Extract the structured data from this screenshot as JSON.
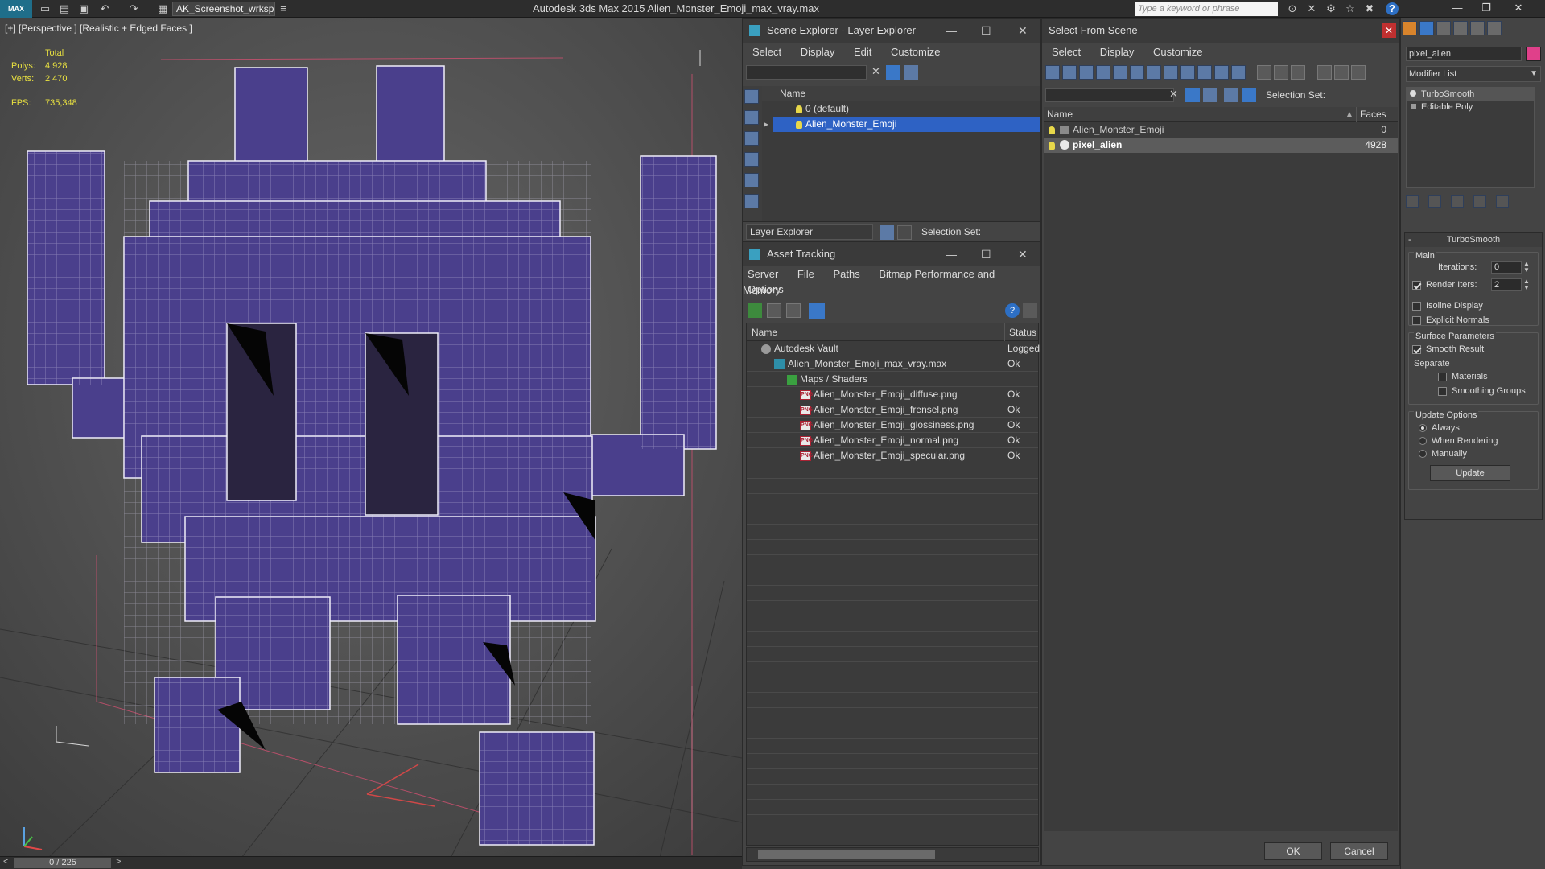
{
  "app": {
    "logo": "MAX",
    "workspace": "AK_Screenshot_wrksp",
    "title": "Autodesk 3ds Max  2015     Alien_Monster_Emoji_max_vray.max",
    "search_placeholder": "Type a keyword or phrase"
  },
  "viewport": {
    "label": "[+] [Perspective ] [Realistic + Edged Faces ]",
    "stats": {
      "total_label": "Total",
      "polys_label": "Polys:",
      "polys": "4 928",
      "verts_label": "Verts:",
      "verts": "2 470",
      "fps_label": "FPS:",
      "fps": "735,348"
    },
    "timeline": "0 / 225"
  },
  "scene_explorer": {
    "title": "Scene Explorer - Layer Explorer",
    "menu": [
      "Select",
      "Display",
      "Edit",
      "Customize"
    ],
    "column": "Name",
    "rows": [
      {
        "label": "0 (default)",
        "selected": false
      },
      {
        "label": "Alien_Monster_Emoji",
        "selected": true
      }
    ],
    "footer_mode": "Layer Explorer",
    "selection_set_label": "Selection Set:"
  },
  "asset_tracking": {
    "title": "Asset Tracking",
    "menu1": [
      "Server",
      "File",
      "Paths",
      "Bitmap Performance and Memory"
    ],
    "menu2": [
      "Options"
    ],
    "columns": [
      "Name",
      "Status"
    ],
    "rows": [
      {
        "name": "Autodesk Vault",
        "status": "Logged",
        "indent": 0,
        "type": "vault"
      },
      {
        "name": "Alien_Monster_Emoji_max_vray.max",
        "status": "Ok",
        "indent": 1,
        "type": "max"
      },
      {
        "name": "Maps / Shaders",
        "status": "",
        "indent": 2,
        "type": "maps"
      },
      {
        "name": "Alien_Monster_Emoji_diffuse.png",
        "status": "Ok",
        "indent": 3,
        "type": "png"
      },
      {
        "name": "Alien_Monster_Emoji_frensel.png",
        "status": "Ok",
        "indent": 3,
        "type": "png"
      },
      {
        "name": "Alien_Monster_Emoji_glossiness.png",
        "status": "Ok",
        "indent": 3,
        "type": "png"
      },
      {
        "name": "Alien_Monster_Emoji_normal.png",
        "status": "Ok",
        "indent": 3,
        "type": "png"
      },
      {
        "name": "Alien_Monster_Emoji_specular.png",
        "status": "Ok",
        "indent": 3,
        "type": "png"
      }
    ],
    "png_badge": "PNG"
  },
  "select_from_scene": {
    "title": "Select From Scene",
    "menu": [
      "Select",
      "Display",
      "Customize"
    ],
    "selection_set_label": "Selection Set:",
    "columns": [
      "Name",
      "Faces"
    ],
    "rows": [
      {
        "name": "Alien_Monster_Emoji",
        "faces": "0",
        "selected": false
      },
      {
        "name": "pixel_alien",
        "faces": "4928",
        "selected": true
      }
    ],
    "ok": "OK",
    "cancel": "Cancel"
  },
  "command_panel": {
    "object_name": "pixel_alien",
    "object_color": "#e0408a",
    "modifier_list": "Modifier List",
    "stack": [
      "TurboSmooth",
      "Editable Poly"
    ],
    "rollout_title": "TurboSmooth",
    "main_label": "Main",
    "iterations_label": "Iterations:",
    "iterations": "0",
    "render_iters_label": "Render Iters:",
    "render_iters": "2",
    "isoline": "Isoline Display",
    "explicit_normals": "Explicit Normals",
    "surface_params": "Surface Parameters",
    "smooth_result": "Smooth Result",
    "separate": "Separate",
    "materials": "Materials",
    "smoothing_groups": "Smoothing Groups",
    "update_options": "Update Options",
    "always": "Always",
    "when_rendering": "When Rendering",
    "manually": "Manually",
    "update_button": "Update"
  },
  "colors": {
    "alien": "#4a3f8c",
    "selection": "#2e62c4",
    "accent": "#1f6e8a"
  }
}
